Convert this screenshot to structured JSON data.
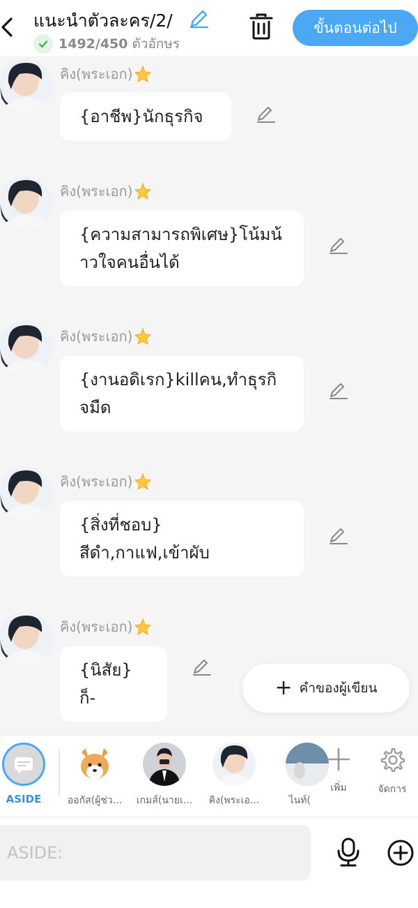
{
  "header": {
    "title": "แนะนำตัวละคร/2/",
    "char_count": "1492/450",
    "char_unit": "ตัวอักษร",
    "next_label": "ขั้นตอนต่อไป"
  },
  "messages": [
    {
      "name": "คิง(พระเอก)",
      "text": "{อาชีพ}นักธุรกิจ"
    },
    {
      "name": "คิง(พระเอก)",
      "text": "{ความสามารถพิเศษ}โน้มน้าวใจคนอื่นได้"
    },
    {
      "name": "คิง(พระเอก)",
      "text": "{งานอดิเรก}killคน,ทำธุรกิจมืด"
    },
    {
      "name": "คิง(พระเอก)",
      "text": "{สิ่งที่ชอบ}\nสีดำ,กาแฟ,เข้าผับ"
    },
    {
      "name": "คิง(พระเอก)",
      "text": "{นิสัย}ก็-"
    }
  ],
  "author_words_label": "คำของผู้เขียน",
  "characters": [
    {
      "label": "ASIDE"
    },
    {
      "label": "ออกัส(ผู้ช่ว..."
    },
    {
      "label": "เกมส์(นายเ..."
    },
    {
      "label": "คิง(พระเอ..."
    },
    {
      "label": "ไนท์("
    }
  ],
  "tools": {
    "add_label": "เพิ่ม",
    "manage_label": "จัดการ"
  },
  "input": {
    "placeholder": "ASIDE:"
  },
  "colors": {
    "accent": "#4aa8f5",
    "aside_label": "#3a8fde",
    "check_green": "#3cb55a"
  }
}
